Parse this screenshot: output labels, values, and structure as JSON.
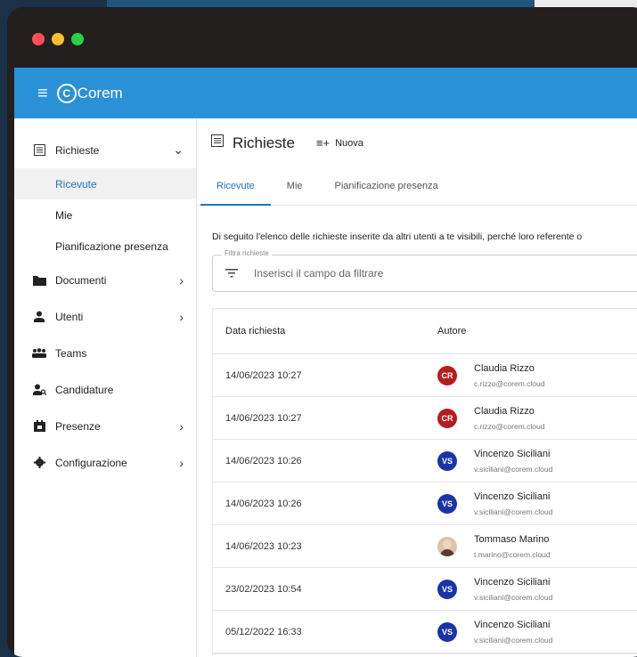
{
  "app": {
    "logo_text": "Corem",
    "logo_mark": "C"
  },
  "sidebar": {
    "items": [
      {
        "label": "Richieste",
        "icon": "list-icon",
        "chevron": "⌄"
      },
      {
        "label": "Documenti",
        "icon": "folder-icon",
        "chevron": "›"
      },
      {
        "label": "Utenti",
        "icon": "user-icon",
        "chevron": "›"
      },
      {
        "label": "Teams",
        "icon": "teams-icon"
      },
      {
        "label": "Candidature",
        "icon": "candidature-icon"
      },
      {
        "label": "Presenze",
        "icon": "calendar-icon",
        "chevron": "›"
      },
      {
        "label": "Configurazione",
        "icon": "gear-icon",
        "chevron": "›"
      }
    ],
    "sub_items": [
      "Ricevute",
      "Mie",
      "Pianificazione presenza"
    ]
  },
  "page": {
    "title": "Richieste",
    "new_label": "Nuova"
  },
  "tabs": [
    "Ricevute",
    "Mie",
    "Pianificazione presenza"
  ],
  "description": "Di seguito l'elenco delle richieste inserite da altri utenti a te visibili, perché loro referente o",
  "filter": {
    "legend": "Filtra richieste",
    "placeholder": "Inserisci il campo da filtrare"
  },
  "table": {
    "headers": [
      "Data richiesta",
      "Autore"
    ],
    "rows": [
      {
        "date": "14/06/2023 10:27",
        "initials": "CR",
        "name": "Claudia Rizzo",
        "email": "c.rizzo@corem.cloud",
        "color": "#b71c1c"
      },
      {
        "date": "14/06/2023 10:27",
        "initials": "CR",
        "name": "Claudia Rizzo",
        "email": "c.rizzo@corem.cloud",
        "color": "#b71c1c"
      },
      {
        "date": "14/06/2023 10:26",
        "initials": "VS",
        "name": "Vincenzo Siciliani",
        "email": "v.siciliani@corem.cloud",
        "color": "#1a34a8"
      },
      {
        "date": "14/06/2023 10:26",
        "initials": "VS",
        "name": "Vincenzo Siciliani",
        "email": "v.siciliani@corem.cloud",
        "color": "#1a34a8"
      },
      {
        "date": "14/06/2023 10:23",
        "initials": "",
        "name": "Tommaso Marino",
        "email": "t.marino@corem.cloud",
        "color": "#d8c3ab"
      },
      {
        "date": "23/02/2023 10:54",
        "initials": "VS",
        "name": "Vincenzo Siciliani",
        "email": "v.siciliani@corem.cloud",
        "color": "#1a34a8"
      },
      {
        "date": "05/12/2022 16:33",
        "initials": "VS",
        "name": "Vincenzo Siciliani",
        "email": "v.siciliani@corem.cloud",
        "color": "#1a34a8"
      }
    ]
  },
  "colors": {
    "appbar": "#2a91d6",
    "accent": "#1c75c4"
  }
}
